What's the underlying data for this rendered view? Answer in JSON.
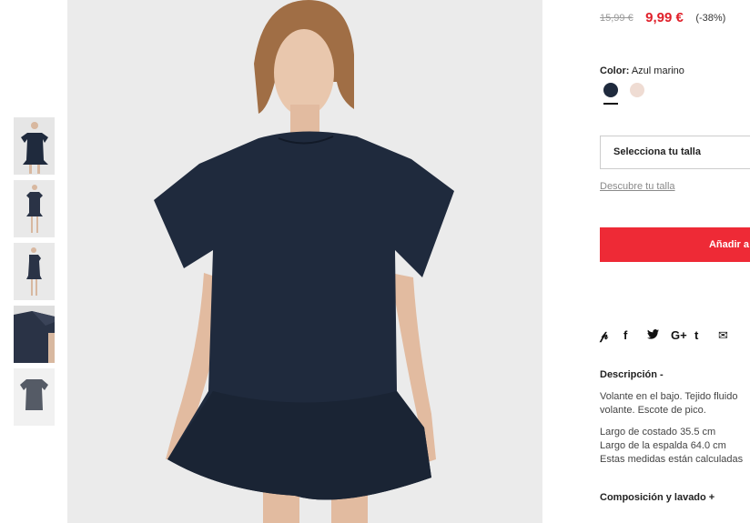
{
  "product": {
    "old_price": "15,99 €",
    "new_price": "9,99 €",
    "discount": "(-38%)",
    "color_label": "Color:",
    "color_value": "Azul marino",
    "colors": [
      "#1f2a3d",
      "#efdcd3"
    ],
    "size_select_label": "Selecciona tu talla",
    "size_guide_link": "Descubre tu talla",
    "add_button_label": "Añadir a"
  },
  "share_icons": [
    "pinterest-icon",
    "facebook-icon",
    "twitter-icon",
    "google-plus-icon",
    "tumblr-icon",
    "mail-icon"
  ],
  "share_glyphs": [
    "℗",
    "f",
    "🐦",
    "G+",
    "t",
    "✉"
  ],
  "description": {
    "title": "Descripción  -",
    "line1": "Volante en el bajo. Tejido fluido",
    "line2": "volante. Escote de pico.",
    "measure1": "Largo de costado 35.5 cm",
    "measure2": "Largo de la espalda 64.0 cm",
    "measure3": "Estas medidas están calculadas"
  },
  "composition": {
    "title": "Composición y lavado  +"
  },
  "accent_colors": {
    "sale_red": "#e0202a",
    "button_red": "#ee2a36",
    "dress_navy": "#1f2a3d"
  }
}
